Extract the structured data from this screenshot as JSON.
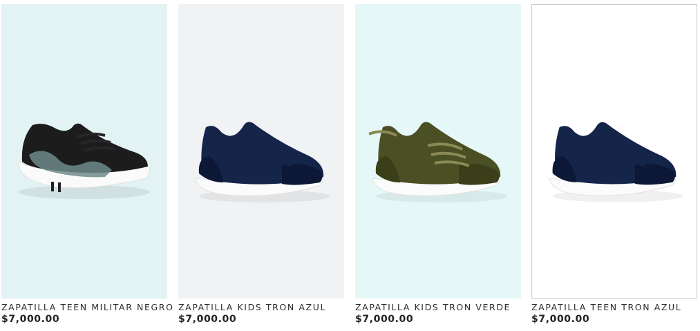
{
  "products": [
    {
      "title": "ZAPATILLA TEEN MILITAR NEGRO",
      "price": "$7,000.00",
      "bg": "#e3f3f3",
      "shoe_color": "#1c1c1c",
      "accent": "#6d8a8a",
      "lace": "#262626",
      "icon": "sneaker-black-camo-icon"
    },
    {
      "title": "ZAPATILLA KIDS TRON AZUL",
      "price": "$7,000.00",
      "bg": "#f0f2f4",
      "shoe_color": "#152449",
      "accent": "#0c1836",
      "lace": "#152449",
      "icon": "sneaker-navy-icon"
    },
    {
      "title": "ZAPATILLA KIDS TRON VERDE",
      "price": "$7,000.00",
      "bg": "#e5f8f7",
      "shoe_color": "#4b4f24",
      "accent": "#3a3e19",
      "lace": "#8a8a55",
      "icon": "sneaker-olive-icon"
    },
    {
      "title": "ZAPATILLA TEEN TRON AZUL",
      "price": "$7,000.00",
      "bg": "#ffffff",
      "shoe_color": "#152449",
      "accent": "#0c1836",
      "lace": "#152449",
      "icon": "sneaker-navy-icon"
    }
  ]
}
